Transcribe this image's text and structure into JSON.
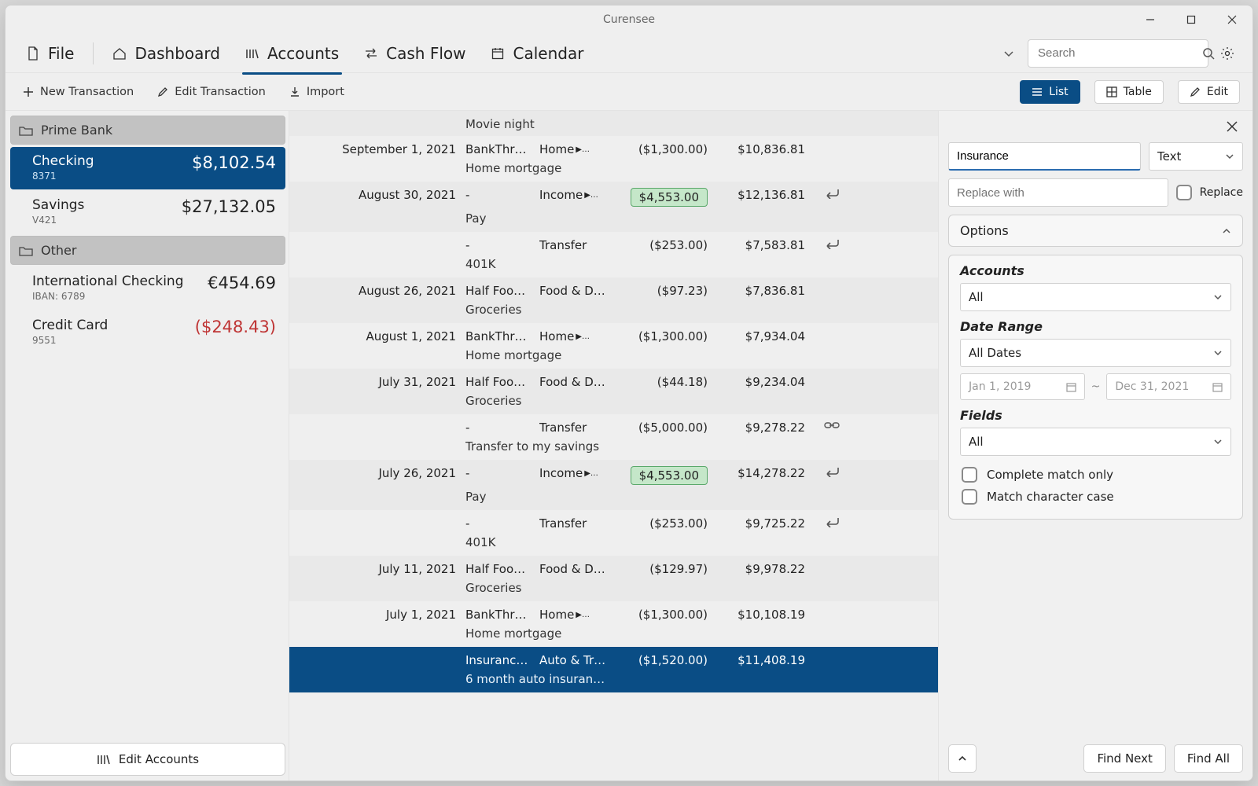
{
  "window": {
    "title": "Curensee"
  },
  "menubar": {
    "file": "File",
    "dashboard": "Dashboard",
    "accounts": "Accounts",
    "cashflow": "Cash Flow",
    "calendar": "Calendar",
    "search_placeholder": "Search"
  },
  "toolbar": {
    "new_tx": "New Transaction",
    "edit_tx": "Edit Transaction",
    "import": "Import",
    "view_list": "List",
    "view_table": "Table",
    "view_edit": "Edit"
  },
  "sidebar": {
    "group1": "Prime Bank",
    "group2": "Other",
    "edit_accounts": "Edit Accounts",
    "accounts": {
      "checking": {
        "name": "Checking",
        "sub": "8371",
        "bal": "$8,102.54"
      },
      "savings": {
        "name": "Savings",
        "sub": "V421",
        "bal": "$27,132.05"
      },
      "intl": {
        "name": "International Checking",
        "sub": "IBAN: 6789",
        "bal": "€454.69"
      },
      "credit": {
        "name": "Credit Card",
        "sub": "9551",
        "bal": "($248.43)"
      }
    }
  },
  "txheader_memo": "Movie night",
  "tx": [
    {
      "date": "September 1, 2021",
      "payee": "BankThr…",
      "cat": "Home",
      "cat_more": true,
      "amt": "($1,300.00)",
      "bal": "$10,836.81",
      "memo": "Home mortgage",
      "alt": false
    },
    {
      "date": "August 30, 2021",
      "payee": "-",
      "cat": "Income",
      "cat_more": true,
      "amt": "$4,553.00",
      "amt_chip": true,
      "bal": "$12,136.81",
      "memo": "Pay",
      "action": "return",
      "alt": true
    },
    {
      "date": "",
      "payee": "-",
      "cat": "Transfer",
      "amt": "($253.00)",
      "bal": "$7,583.81",
      "memo": "401K",
      "action": "return",
      "alt": false
    },
    {
      "date": "August 26, 2021",
      "payee": "Half Foo…",
      "cat": "Food & D…",
      "amt": "($97.23)",
      "bal": "$7,836.81",
      "memo": "Groceries",
      "alt": true
    },
    {
      "date": "August 1, 2021",
      "payee": "BankThr…",
      "cat": "Home",
      "cat_more": true,
      "amt": "($1,300.00)",
      "bal": "$7,934.04",
      "memo": "Home mortgage",
      "alt": false
    },
    {
      "date": "July 31, 2021",
      "payee": "Half Foo…",
      "cat": "Food & D…",
      "amt": "($44.18)",
      "bal": "$9,234.04",
      "memo": "Groceries",
      "alt": true
    },
    {
      "date": "",
      "payee": "-",
      "cat": "Transfer",
      "amt": "($5,000.00)",
      "bal": "$9,278.22",
      "memo": "Transfer to my savings",
      "action": "link",
      "alt": false
    },
    {
      "date": "July 26, 2021",
      "payee": "-",
      "cat": "Income",
      "cat_more": true,
      "amt": "$4,553.00",
      "amt_chip": true,
      "bal": "$14,278.22",
      "memo": "Pay",
      "action": "return",
      "alt": true
    },
    {
      "date": "",
      "payee": "-",
      "cat": "Transfer",
      "amt": "($253.00)",
      "bal": "$9,725.22",
      "memo": "401K",
      "action": "return",
      "alt": false
    },
    {
      "date": "July 11, 2021",
      "payee": "Half Foo…",
      "cat": "Food & D…",
      "amt": "($129.97)",
      "bal": "$9,978.22",
      "memo": "Groceries",
      "alt": true
    },
    {
      "date": "July 1, 2021",
      "payee": "BankThr…",
      "cat": "Home",
      "cat_more": true,
      "amt": "($1,300.00)",
      "bal": "$10,108.19",
      "memo": "Home mortgage",
      "alt": false
    },
    {
      "date": "",
      "payee": "Insuranc…",
      "cat": "Auto & Tr…",
      "amt": "($1,520.00)",
      "bal": "$11,408.19",
      "memo": "6 month auto insuran…",
      "alt": true,
      "sel": true
    }
  ],
  "search_panel": {
    "find_value": "Insurance",
    "type_value": "Text",
    "replace_placeholder": "Replace with",
    "replace_label": "Replace",
    "options_label": "Options",
    "accounts_label": "Accounts",
    "accounts_value": "All",
    "daterange_label": "Date Range",
    "daterange_value": "All Dates",
    "date_from": "Jan 1, 2019",
    "date_sep": "~",
    "date_to": "Dec 31, 2021",
    "fields_label": "Fields",
    "fields_value": "All",
    "complete_match": "Complete match only",
    "match_case": "Match character case",
    "find_next": "Find Next",
    "find_all": "Find All"
  }
}
